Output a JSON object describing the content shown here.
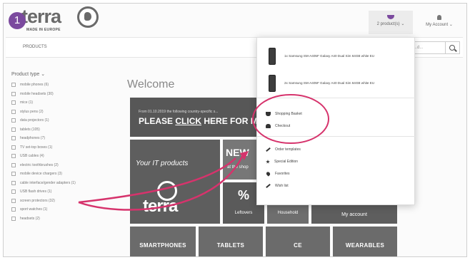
{
  "header": {
    "step_number": "1",
    "logo_text": "terra",
    "logo_tagline": "MADE IN EUROPE",
    "products_button_label": "2 product(s) ⌄",
    "account_button_label": "My Account ⌄"
  },
  "navbar": {
    "products_label": "PRODUCTS",
    "search_placeholder": "...d..."
  },
  "sidebar": {
    "heading": "Product type ⌄",
    "items": [
      "mobile phones (6)",
      "mobile headsets (30)",
      "mice (1)",
      "stylus pens (2)",
      "data projectors (1)",
      "tablets (105)",
      "headphones (7)",
      "TV set-top boxes (1)",
      "USB cables (4)",
      "electric toothbrushes (2)",
      "mobile device chargers (3)",
      "cable interface/gender adapters (1)",
      "USB flash drives (1)",
      "screen protectors (32)",
      "sport watches (1)",
      "headsets (2)"
    ]
  },
  "main": {
    "welcome": "Welcome",
    "banner_small": "From 01.10.2019 the following country-specific s...",
    "banner_big_prefix": "PLEASE ",
    "banner_big_link": "CLICK",
    "banner_big_suffix": " HERE FOR MOR",
    "tile_products_caption": "Your IT products",
    "tile_products_word": "terra",
    "tile_new_big": "NEW",
    "tile_new_small": "at the shop",
    "tile_leftovers_big": "%",
    "tile_leftovers_small": "Leftovers",
    "tile_household_big": "&",
    "tile_household_small": "Household",
    "tile_account_small": "My account",
    "categories": [
      "SMARTPHONES",
      "TABLETS",
      "CE",
      "WEARABLES"
    ]
  },
  "dropdown": {
    "products": [
      "1x Samsung SM-A405F Galaxy A40 Dual Sim 64GB white EU",
      "2x Samsung SM-A405F Galaxy A40 Dual Sim 64GB white EU"
    ],
    "shopping_basket": "Shopping Basket",
    "checkout": "Checkout",
    "order_templates": "Order templates",
    "special_edition": "Special Edition",
    "favorites": "Favorites",
    "wish_list": "Wish list"
  },
  "colors": {
    "accent": "#7b4a9e",
    "annotation": "#d6336c",
    "tile_dark": "#5e5e5e"
  }
}
